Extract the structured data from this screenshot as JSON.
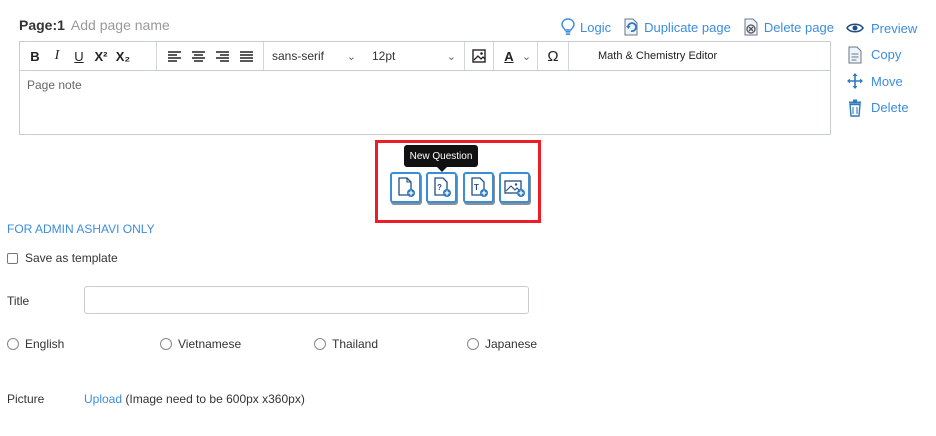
{
  "page": {
    "number_label": "Page:1",
    "name_placeholder": "Add page name"
  },
  "header_actions": {
    "logic": "Logic",
    "duplicate": "Duplicate page",
    "delete": "Delete page"
  },
  "side_actions": {
    "preview": "Preview",
    "copy": "Copy",
    "move": "Move",
    "delete": "Delete"
  },
  "toolbar": {
    "bold": "B",
    "italic": "I",
    "underline": "U",
    "superscript": "X²",
    "subscript": "X₂",
    "font_family": "sans-serif",
    "font_size": "12pt",
    "text_color": "A",
    "special_char": "Ω",
    "math_editor": "Math & Chemistry Editor"
  },
  "editor": {
    "placeholder": "Page note"
  },
  "question_tools": {
    "tooltip": "New Question",
    "icons": [
      "add-page-icon",
      "new-question-icon",
      "add-text-icon",
      "add-image-icon"
    ],
    "highlight_color": "#ee1c25"
  },
  "admin": {
    "label": "FOR ADMIN ASHAVI ONLY",
    "save_template": "Save as template",
    "title_label": "Title",
    "languages": [
      "English",
      "Vietnamese",
      "Thailand",
      "Japanese"
    ],
    "picture_label": "Picture",
    "upload_link": "Upload",
    "upload_hint": " (Image need to be 600px x360px)"
  },
  "colors": {
    "link": "#3c8dde",
    "accent_border": "#3a8fd4"
  }
}
